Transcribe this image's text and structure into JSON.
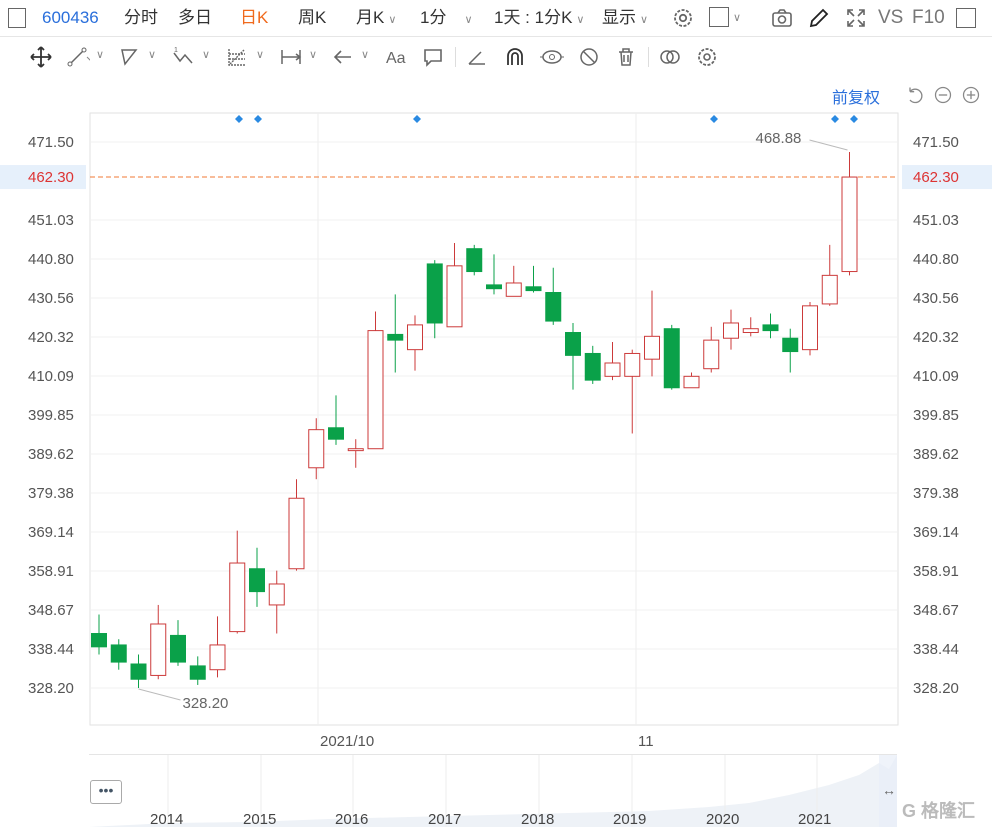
{
  "topbar": {
    "code": "600436",
    "tabs": [
      "分时",
      "多日",
      "日K",
      "周K",
      "月K",
      "1分"
    ],
    "active_tab": "日K",
    "interval": "1天 : 1分K",
    "display": "显示",
    "vs_label": "VS",
    "f10_label": "F10"
  },
  "toolbar": {
    "icons": [
      "move-icon",
      "line-icon",
      "polyline-icon",
      "wave-icon",
      "fib-icon",
      "range-icon",
      "arrow-icon",
      "text-icon",
      "comment-icon",
      "ruler-icon",
      "magnet-icon",
      "eye-lock-icon",
      "eye-off-icon",
      "trash-icon",
      "compare-icon",
      "settings-icon"
    ],
    "text_icon_label": "Aa"
  },
  "adjust": {
    "label": "前复权"
  },
  "chart_data": {
    "type": "candlestick",
    "y_ticks": [
      "471.50",
      "451.03",
      "440.80",
      "430.56",
      "420.32",
      "410.09",
      "399.85",
      "389.62",
      "379.38",
      "369.14",
      "358.91",
      "348.67",
      "338.44",
      "328.20"
    ],
    "ylim": [
      323,
      479
    ],
    "highlight_price": "462.30",
    "max_label": "468.88",
    "min_label": "328.20",
    "x_labels": [
      "2021/10",
      "11"
    ],
    "candles": [
      {
        "o": 342.5,
        "h": 347.5,
        "l": 337.0,
        "c": 339.0
      },
      {
        "o": 339.5,
        "h": 341.0,
        "l": 333.0,
        "c": 335.0
      },
      {
        "o": 334.5,
        "h": 337.0,
        "l": 328.2,
        "c": 330.5
      },
      {
        "o": 331.5,
        "h": 350.0,
        "l": 330.5,
        "c": 345.0
      },
      {
        "o": 342.0,
        "h": 346.0,
        "l": 334.0,
        "c": 335.0
      },
      {
        "o": 334.0,
        "h": 336.5,
        "l": 329.0,
        "c": 330.5
      },
      {
        "o": 333.0,
        "h": 347.0,
        "l": 331.0,
        "c": 339.5
      },
      {
        "o": 343.0,
        "h": 369.5,
        "l": 342.5,
        "c": 361.0
      },
      {
        "o": 359.5,
        "h": 365.0,
        "l": 349.5,
        "c": 353.5
      },
      {
        "o": 350.0,
        "h": 359.0,
        "l": 342.5,
        "c": 355.5
      },
      {
        "o": 359.5,
        "h": 383.0,
        "l": 359.0,
        "c": 378.0
      },
      {
        "o": 386.0,
        "h": 399.0,
        "l": 383.0,
        "c": 396.0
      },
      {
        "o": 396.5,
        "h": 405.0,
        "l": 392.0,
        "c": 393.5
      },
      {
        "o": 390.5,
        "h": 393.5,
        "l": 386.0,
        "c": 391.0
      },
      {
        "o": 391.0,
        "h": 427.0,
        "l": 391.0,
        "c": 422.0
      },
      {
        "o": 421.0,
        "h": 431.5,
        "l": 411.0,
        "c": 419.5
      },
      {
        "o": 417.0,
        "h": 426.0,
        "l": 411.5,
        "c": 423.5
      },
      {
        "o": 439.5,
        "h": 440.5,
        "l": 420.0,
        "c": 424.0
      },
      {
        "o": 423.0,
        "h": 445.0,
        "l": 423.0,
        "c": 439.0
      },
      {
        "o": 443.5,
        "h": 444.5,
        "l": 436.5,
        "c": 437.5
      },
      {
        "o": 434.0,
        "h": 442.0,
        "l": 431.5,
        "c": 433.0
      },
      {
        "o": 431.0,
        "h": 439.0,
        "l": 431.0,
        "c": 434.5
      },
      {
        "o": 433.5,
        "h": 439.0,
        "l": 432.0,
        "c": 432.5
      },
      {
        "o": 432.0,
        "h": 438.5,
        "l": 423.5,
        "c": 424.5
      },
      {
        "o": 421.5,
        "h": 424.0,
        "l": 406.5,
        "c": 415.5
      },
      {
        "o": 416.0,
        "h": 418.0,
        "l": 408.0,
        "c": 409.0
      },
      {
        "o": 410.0,
        "h": 419.0,
        "l": 409.0,
        "c": 413.5
      },
      {
        "o": 410.0,
        "h": 417.0,
        "l": 395.0,
        "c": 416.0
      },
      {
        "o": 414.5,
        "h": 432.5,
        "l": 410.0,
        "c": 420.5
      },
      {
        "o": 422.5,
        "h": 423.5,
        "l": 406.5,
        "c": 407.0
      },
      {
        "o": 407.0,
        "h": 411.0,
        "l": 407.0,
        "c": 410.0
      },
      {
        "o": 412.0,
        "h": 423.0,
        "l": 411.0,
        "c": 419.5
      },
      {
        "o": 420.0,
        "h": 427.5,
        "l": 417.0,
        "c": 424.0
      },
      {
        "o": 421.5,
        "h": 425.5,
        "l": 420.5,
        "c": 422.5
      },
      {
        "o": 423.5,
        "h": 426.5,
        "l": 420.0,
        "c": 422.0
      },
      {
        "o": 420.0,
        "h": 422.5,
        "l": 411.0,
        "c": 416.5
      },
      {
        "o": 417.0,
        "h": 429.5,
        "l": 415.5,
        "c": 428.5
      },
      {
        "o": 429.0,
        "h": 444.5,
        "l": 428.5,
        "c": 436.5
      },
      {
        "o": 437.5,
        "h": 468.88,
        "l": 436.5,
        "c": 462.3
      }
    ]
  },
  "navigator": {
    "years": [
      "2014",
      "2015",
      "2016",
      "2017",
      "2018",
      "2019",
      "2020",
      "2021"
    ],
    "more_label": "•••"
  },
  "watermark": "G 格隆汇",
  "colors": {
    "up": "#cc3a3a",
    "down": "#0aa149",
    "price_line": "#f07a35",
    "accent": "#2a6fdb"
  }
}
